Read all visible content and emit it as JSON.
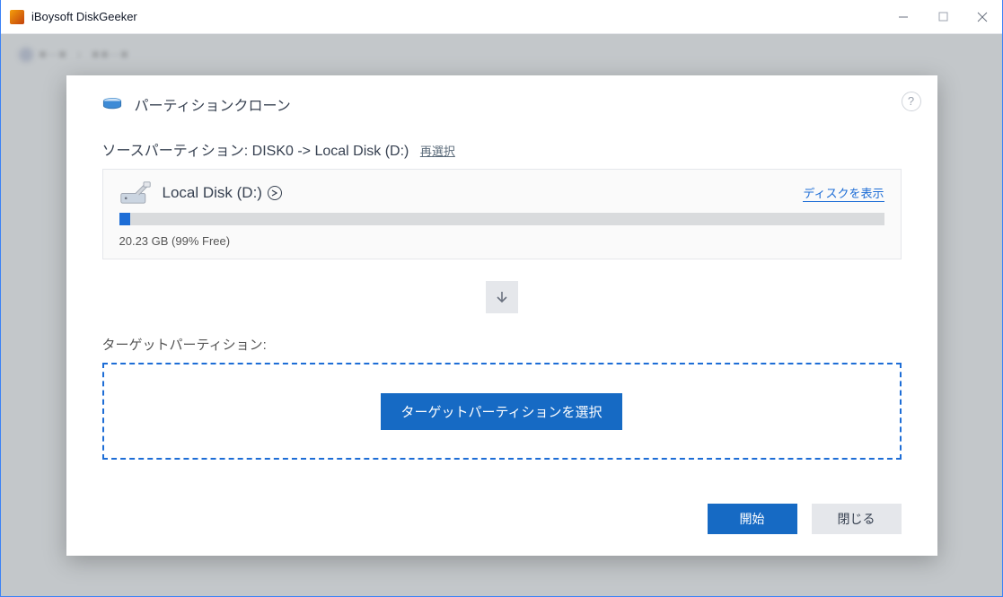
{
  "app": {
    "title": "iBoysoft DiskGeeker"
  },
  "dialog": {
    "title": "パーティションクローン",
    "help_label": "?"
  },
  "source": {
    "label_prefix": "ソースパーティション:",
    "path": "DISK0 -> Local Disk (D:)",
    "reselect_label": "再選択",
    "disk_name": "Local Disk (D:)",
    "show_disk_label": "ディスクを表示",
    "usage_text": "20.23 GB (99% Free)",
    "usage_percent_used": 1
  },
  "target": {
    "label": "ターゲットパーティション:",
    "select_button": "ターゲットパーティションを選択"
  },
  "footer": {
    "start_label": "開始",
    "close_label": "閉じる"
  }
}
